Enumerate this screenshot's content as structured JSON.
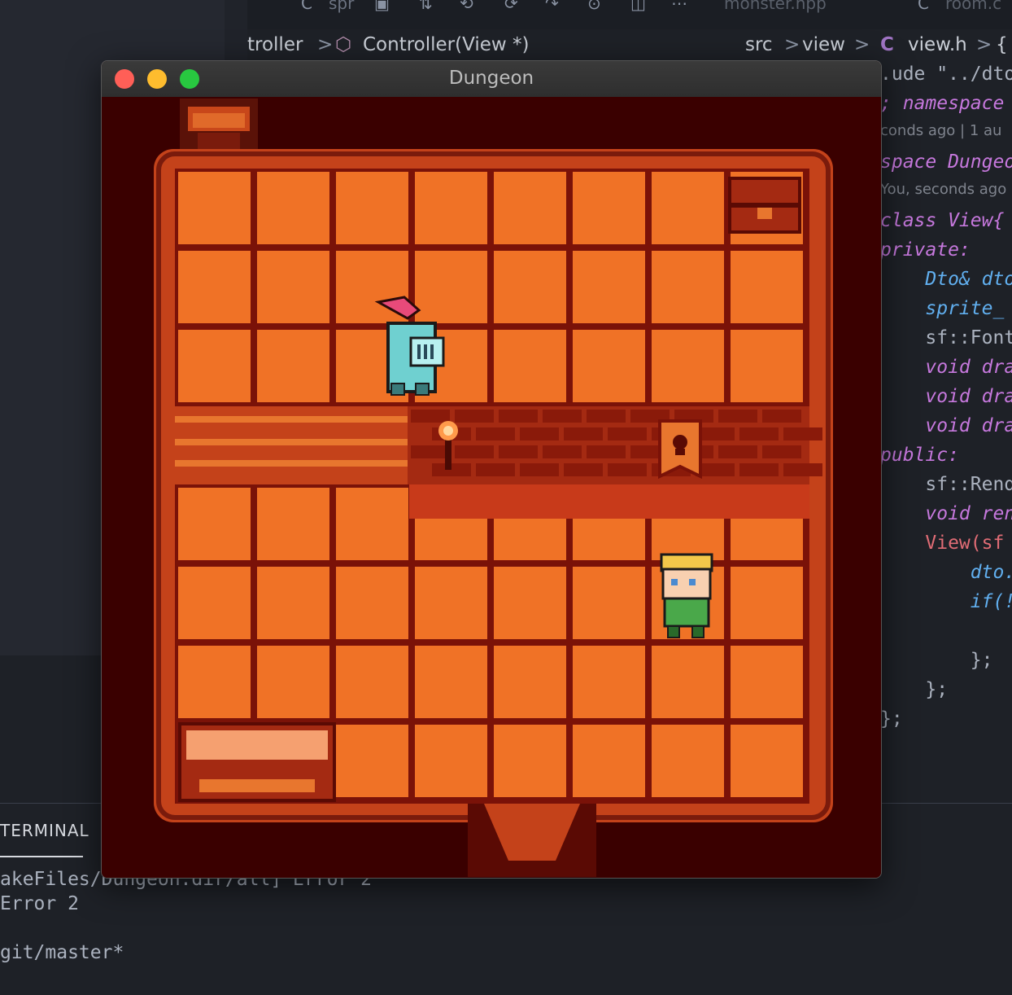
{
  "ide": {
    "tabs": [
      "spr",
      "monster.hpp",
      "room.c"
    ],
    "breadcrumbs_left": [
      "troller",
      ">",
      "Controller(View *)"
    ],
    "breadcrumbs_right": [
      "src",
      ">",
      "view",
      ">",
      "C",
      "view.h",
      ">",
      "{"
    ],
    "code_lines": [
      {
        "text": ".ude \"../dto",
        "cls": "pl"
      },
      {
        "text": "; namespace",
        "cls": "kw"
      },
      {
        "text": "conds ago | 1 au",
        "cls": "cm"
      },
      {
        "text": "space Dungeo",
        "cls": "kw"
      },
      {
        "text": "You, seconds ago",
        "cls": "cm"
      },
      {
        "text": "class View{",
        "cls": "kw"
      },
      {
        "text": "private:",
        "cls": "kw"
      },
      {
        "text": "    Dto& dto",
        "cls": "ty"
      },
      {
        "text": "    sprite_",
        "cls": "ty"
      },
      {
        "text": "    sf::Font",
        "cls": "pl"
      },
      {
        "text": "    void dra",
        "cls": "kw"
      },
      {
        "text": "    void dra",
        "cls": "kw"
      },
      {
        "text": "    void dra",
        "cls": "kw"
      },
      {
        "text": "public:",
        "cls": "kw"
      },
      {
        "text": "    sf::Rend",
        "cls": "pl"
      },
      {
        "text": "    void ren",
        "cls": "kw"
      },
      {
        "text": "    View(sf",
        "cls": "fn"
      },
      {
        "text": "        dto.",
        "cls": "ty"
      },
      {
        "text": "        if(!",
        "cls": "ty"
      },
      {
        "text": "",
        "cls": "pl"
      },
      {
        "text": "        };",
        "cls": "pl"
      },
      {
        "text": "    };",
        "cls": "pl"
      },
      {
        "text": "};",
        "cls": "pl"
      }
    ],
    "terminal": {
      "tab_label": "TERMINAL",
      "lines": [
        "akeFiles/Dungeon.dir/all] Error 2",
        "Error 2",
        "",
        "git/master*"
      ]
    }
  },
  "window": {
    "title": "Dungeon"
  }
}
